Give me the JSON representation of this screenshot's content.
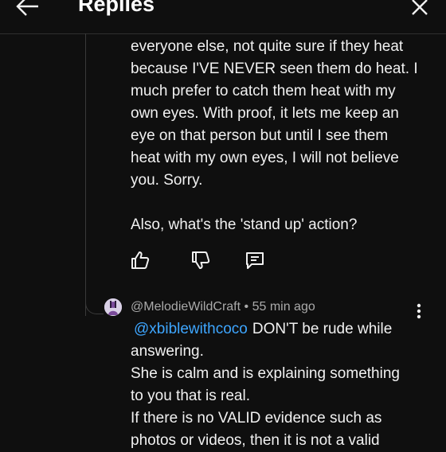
{
  "header": {
    "title": "Replies",
    "back_icon": "arrow-left-icon",
    "close_icon": "close-icon"
  },
  "comment": {
    "lines": [
      "everyone else, not quite sure if they heat",
      "because I'VE NEVER seen them do heat. I",
      "much prefer to catch them heat with my",
      "own eyes. With proof, it lets me keep an",
      "eye on that person but until I see them",
      "heat with my own eyes, I will not believe",
      "you. Sorry."
    ],
    "last_line": "Also, what's the 'stand up' action?"
  },
  "actions": {
    "like_icon": "thumbs-up-icon",
    "dislike_icon": "thumbs-down-icon",
    "reply_icon": "comment-icon"
  },
  "reply": {
    "author": "@MelodieWildCraft",
    "separator": "•",
    "time": "55 min ago",
    "mention": "@xbiblewithcoco",
    "first_line_rest": "DON'T be rude while",
    "lines": [
      "answering.",
      "She is calm and is explaining something",
      "to you that is real.",
      "If there is no VALID evidence such as",
      "photos or videos, then it is not a valid"
    ],
    "more_icon": "more-vertical-icon"
  },
  "colors": {
    "background": "#0f0f0f",
    "text": "#f1f1f1",
    "muted": "#aaaaaa",
    "link": "#3ea6ff"
  }
}
